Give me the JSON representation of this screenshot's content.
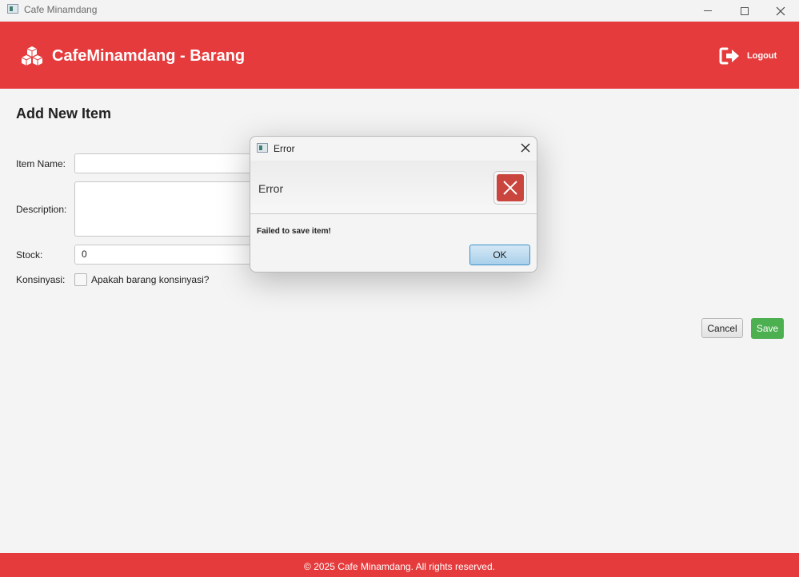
{
  "window": {
    "title": "Cafe Minamdang",
    "icon": "app-icon"
  },
  "header": {
    "brand": "CafeMinamdang - Barang",
    "logo_icon": "cubes-icon",
    "logout_label": "Logout",
    "logout_icon": "logout-icon",
    "background": "#e63b3c"
  },
  "form": {
    "title": "Add New Item",
    "item_name_label": "Item Name:",
    "item_name_value": "",
    "description_label": "Description:",
    "description_value": "",
    "stock_label": "Stock:",
    "stock_value": "0",
    "konsinyasi_label": "Konsinyasi:",
    "konsinyasi_checkbox_label": "Apakah barang konsinyasi?",
    "konsinyasi_checked": false,
    "cancel_label": "Cancel",
    "save_label": "Save",
    "save_color": "#4caf50"
  },
  "dialog": {
    "title": "Error",
    "header_text": "Error",
    "message": "Failed to save item!",
    "ok_label": "OK",
    "icon": "error-icon",
    "error_color": "#c9453e"
  },
  "footer": {
    "text": "© 2025 Cafe Minamdang. All rights reserved."
  }
}
